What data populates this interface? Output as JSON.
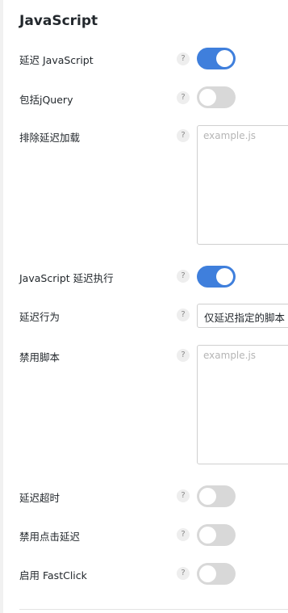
{
  "section_title": "JavaScript",
  "rows": {
    "delay_js": {
      "label": "延迟 JavaScript",
      "help": "?",
      "enabled": true
    },
    "include_jquery": {
      "label": "包括jQuery",
      "help": "?",
      "enabled": false
    },
    "exclude_delay": {
      "label": "排除延迟加载",
      "help": "?",
      "placeholder": "example.js"
    },
    "js_delay_exec": {
      "label": "JavaScript 延迟执行",
      "help": "?",
      "enabled": true
    },
    "delay_behavior": {
      "label": "延迟行为",
      "help": "?",
      "selected": "仅延迟指定的脚本"
    },
    "disable_scripts": {
      "label": "禁用脚本",
      "help": "?",
      "placeholder": "example.js"
    },
    "delay_timeout": {
      "label": "延迟超时",
      "help": "?",
      "enabled": false
    },
    "disable_click_delay": {
      "label": "禁用点击延迟",
      "help": "?",
      "enabled": false
    },
    "enable_fastclick": {
      "label": "启用 FastClick",
      "help": "?",
      "enabled": false
    }
  },
  "colors": {
    "toggle_on": "#3f7fdc",
    "toggle_off": "#d8d8d8"
  }
}
